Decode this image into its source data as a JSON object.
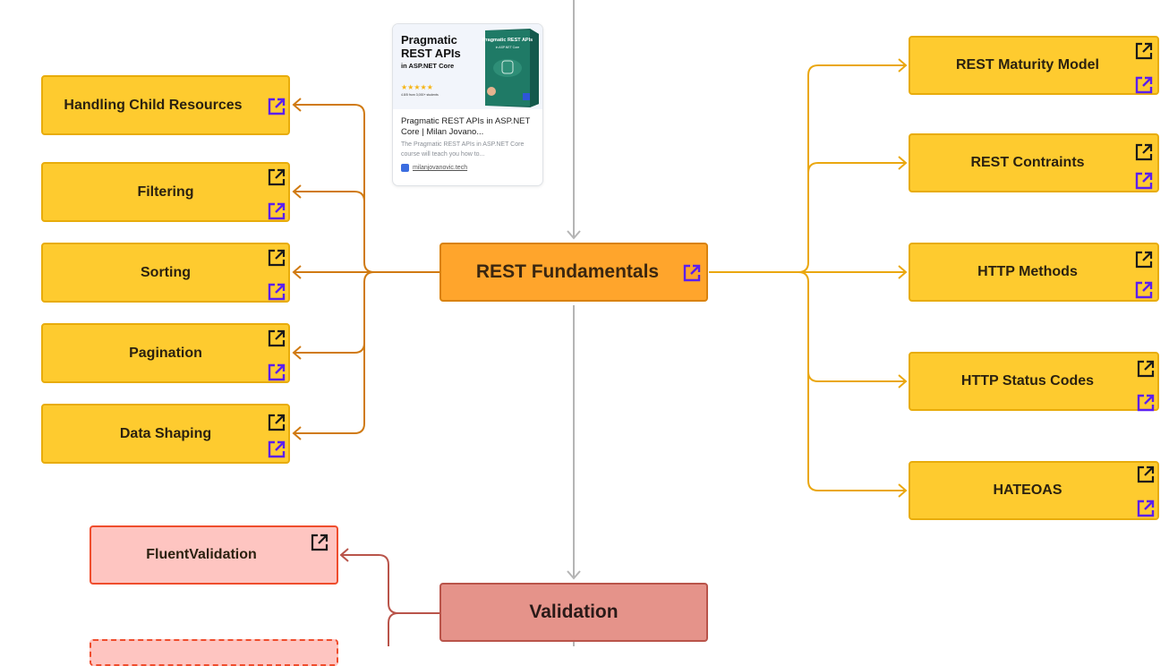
{
  "colors": {
    "topic_fill": "#fecb2f",
    "topic_border": "#e8ac0b",
    "main_fill": "#ffa52c",
    "main_border": "#d9820d",
    "validation_fill": "#e5938a",
    "validation_border": "#b9544a",
    "pink_fill": "#fec5c1",
    "pink_border": "#ef4d2d",
    "left_connector": "#d07a12",
    "right_connector": "#eaa70f",
    "validation_connector": "#b9544a",
    "trunk_connector": "#b5b5b5",
    "link_icon_black": "#1a1a1a",
    "link_icon_purple": "#5b1ff0"
  },
  "main_nodes": {
    "rest_fundamentals": {
      "label": "REST Fundamentals",
      "icon": "external-link-icon"
    },
    "validation": {
      "label": "Validation"
    }
  },
  "left_topics": [
    {
      "label": "Handling Child Resources",
      "icons": [
        "external-link-purple"
      ]
    },
    {
      "label": "Filtering",
      "icons": [
        "external-link-black",
        "external-link-purple"
      ]
    },
    {
      "label": "Sorting",
      "icons": [
        "external-link-black",
        "external-link-purple"
      ]
    },
    {
      "label": "Pagination",
      "icons": [
        "external-link-black",
        "external-link-purple"
      ]
    },
    {
      "label": "Data Shaping",
      "icons": [
        "external-link-black",
        "external-link-purple"
      ]
    }
  ],
  "right_topics": [
    {
      "label": "REST Maturity Model",
      "icons": [
        "external-link-black",
        "external-link-purple"
      ]
    },
    {
      "label": "REST Contraints",
      "icons": [
        "external-link-black",
        "external-link-purple"
      ]
    },
    {
      "label": "HTTP Methods",
      "icons": [
        "external-link-black",
        "external-link-purple"
      ]
    },
    {
      "label": "HTTP Status Codes",
      "icons": [
        "external-link-black",
        "external-link-purple"
      ]
    },
    {
      "label": "HATEOAS",
      "icons": [
        "external-link-black",
        "external-link-purple"
      ]
    }
  ],
  "validation_topics": [
    {
      "label": "FluentValidation",
      "icons": [
        "external-link-black"
      ]
    },
    {
      "label": ""
    }
  ],
  "link_card": {
    "cover_title_line1": "Pragmatic",
    "cover_title_line2": "REST APIs",
    "cover_subtitle": "in ASP.NET Core",
    "stars": "★★★★★",
    "rating_text": "4.8/5 from 3,000+ students",
    "book_title": "Pragmatic REST APIs",
    "book_subtitle": "in ASP.NET Core",
    "title": "Pragmatic REST APIs in ASP.NET Core | Milan Jovano...",
    "description": "The Pragmatic REST APIs in ASP.NET Core course will teach you how to...",
    "domain": "milanjovanovic.tech"
  }
}
